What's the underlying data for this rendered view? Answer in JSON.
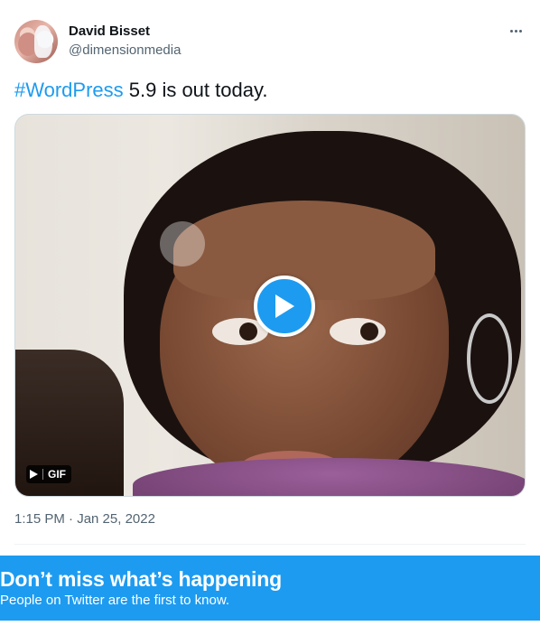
{
  "above": {
    "clipped_text": ""
  },
  "tweet": {
    "author": {
      "display_name": "David Bisset",
      "handle": "@dimensionmedia"
    },
    "text": {
      "hashtag": "#WordPress",
      "rest": " 5.9 is out today."
    },
    "media": {
      "type": "gif",
      "badge_label": "GIF",
      "play_icon": "play-icon"
    },
    "timestamp": "1:15 PM · Jan 25, 2022",
    "more_icon": "more-horizontal-icon"
  },
  "banner": {
    "title": "Don’t miss what’s happening",
    "subtitle": "People on Twitter are the first to know."
  },
  "colors": {
    "accent": "#1d9bf0",
    "text_primary": "#0f1419",
    "text_secondary": "#536471",
    "border": "#cfd9de"
  }
}
